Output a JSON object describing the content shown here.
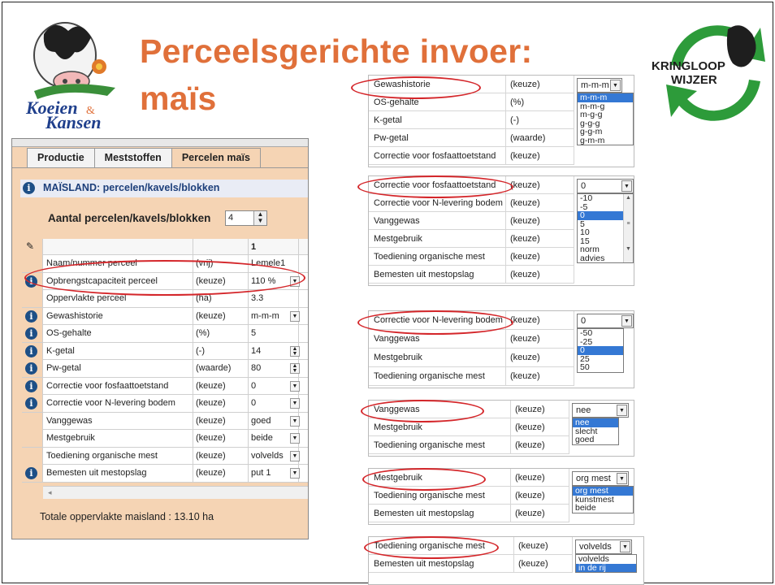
{
  "header": {
    "title_line1": "Perceelsgerichte invoer:",
    "title_line2": "maïs",
    "logo_left_text1": "Koeien",
    "logo_left_amp": "&",
    "logo_left_text2": "Kansen",
    "logo_right_text1": "KRINGLOOP",
    "logo_right_text2": "WIJZER"
  },
  "colors": {
    "title": "#e0703a",
    "panel_bg": "#f5d4b4",
    "highlight": "#d4262a",
    "selection": "#3478d4",
    "info_icon": "#1d4f86"
  },
  "left_panel": {
    "tabs": [
      "Productie",
      "Meststoffen",
      "Percelen maïs"
    ],
    "active_tab": "Percelen maïs",
    "section_title": "MAÏSLAND: percelen/kavels/blokken",
    "count_label": "Aantal percelen/kavels/blokken",
    "count_value": "4",
    "column_header": "1",
    "rows": [
      {
        "label": "Naam/nummer perceel",
        "type": "(vrij)",
        "value": "Lemele1",
        "info": false
      },
      {
        "label": "Opbrengstcapaciteit perceel",
        "type": "(keuze)",
        "value": "110 %",
        "info": true
      },
      {
        "label": "Oppervlakte perceel",
        "type": "(ha)",
        "value": "3.3",
        "info": false
      },
      {
        "label": "Gewashistorie",
        "type": "(keuze)",
        "value": "m-m-m",
        "info": true
      },
      {
        "label": "OS-gehalte",
        "type": "(%)",
        "value": "5",
        "info": true
      },
      {
        "label": "K-getal",
        "type": "(-)",
        "value": "14",
        "info": true
      },
      {
        "label": "Pw-getal",
        "type": "(waarde)",
        "value": "80",
        "info": true
      },
      {
        "label": "Correctie voor fosfaattoetstand",
        "type": "(keuze)",
        "value": "0",
        "info": true
      },
      {
        "label": "Correctie voor N-levering bodem",
        "type": "(keuze)",
        "value": "0",
        "info": true
      },
      {
        "label": "Vanggewas",
        "type": "(keuze)",
        "value": "goed",
        "info": false
      },
      {
        "label": "Mestgebruik",
        "type": "(keuze)",
        "value": "beide",
        "info": false
      },
      {
        "label": "Toediening organische mest",
        "type": "(keuze)",
        "value": "volvelds",
        "info": false
      },
      {
        "label": "Bemesten uit mestopslag",
        "type": "(keuze)",
        "value": "put 1",
        "info": true
      }
    ],
    "total_text": "Totale oppervlakte maisland : 13.10 ha"
  },
  "panel_gewas": {
    "rows": [
      {
        "label": "Gewashistorie",
        "type": "(keuze)"
      },
      {
        "label": "OS-gehalte",
        "type": "(%)"
      },
      {
        "label": "K-getal",
        "type": "(-)"
      },
      {
        "label": "Pw-getal",
        "type": "(waarde)"
      },
      {
        "label": "Correctie voor fosfaattoetstand",
        "type": "(keuze)"
      }
    ],
    "combo_value": "m-m-m",
    "options": [
      "m-m-m",
      "m-m-g",
      "m-g-g",
      "g-g-g",
      "g-g-m",
      "g-m-m"
    ],
    "selected": "m-m-m"
  },
  "panel_fosfaat": {
    "rows": [
      {
        "label": "Correctie voor fosfaattoetstand",
        "type": "(keuze)"
      },
      {
        "label": "Correctie voor N-levering bodem",
        "type": "(keuze)"
      },
      {
        "label": "Vanggewas",
        "type": "(keuze)"
      },
      {
        "label": "Mestgebruik",
        "type": "(keuze)"
      },
      {
        "label": "Toediening organische mest",
        "type": "(keuze)"
      },
      {
        "label": "Bemesten uit mestopslag",
        "type": "(keuze)"
      }
    ],
    "combo_value": "0",
    "options": [
      "-10",
      "-5",
      "0",
      "5",
      "10",
      "15",
      "norm",
      "advies"
    ],
    "selected": "0"
  },
  "panel_nlevering": {
    "rows": [
      {
        "label": "Correctie voor N-levering bodem",
        "type": "(keuze)"
      },
      {
        "label": "Vanggewas",
        "type": "(keuze)"
      },
      {
        "label": "Mestgebruik",
        "type": "(keuze)"
      },
      {
        "label": "Toediening organische mest",
        "type": "(keuze)"
      }
    ],
    "combo_value": "0",
    "options": [
      "-50",
      "-25",
      "0",
      "25",
      "50"
    ],
    "selected": "0"
  },
  "panel_vanggewas": {
    "rows": [
      {
        "label": "Vanggewas",
        "type": "(keuze)"
      },
      {
        "label": "Mestgebruik",
        "type": "(keuze)"
      },
      {
        "label": "Toediening organische mest",
        "type": "(keuze)"
      }
    ],
    "combo_value": "nee",
    "options": [
      "nee",
      "slecht",
      "goed"
    ],
    "selected": "nee"
  },
  "panel_mestgebruik": {
    "rows": [
      {
        "label": "Mestgebruik",
        "type": "(keuze)"
      },
      {
        "label": "Toediening organische mest",
        "type": "(keuze)"
      },
      {
        "label": "Bemesten uit mestopslag",
        "type": "(keuze)"
      }
    ],
    "combo_value": "org mest",
    "options": [
      "org mest",
      "kunstmest",
      "beide"
    ],
    "selected": "org mest"
  },
  "panel_toediening": {
    "rows": [
      {
        "label": "Toediening organische mest",
        "type": "(keuze)"
      },
      {
        "label": "Bemesten uit mestopslag",
        "type": "(keuze)"
      }
    ],
    "combo_value": "volvelds",
    "options": [
      "volvelds",
      "in de rij"
    ],
    "selected": "in de rij"
  }
}
